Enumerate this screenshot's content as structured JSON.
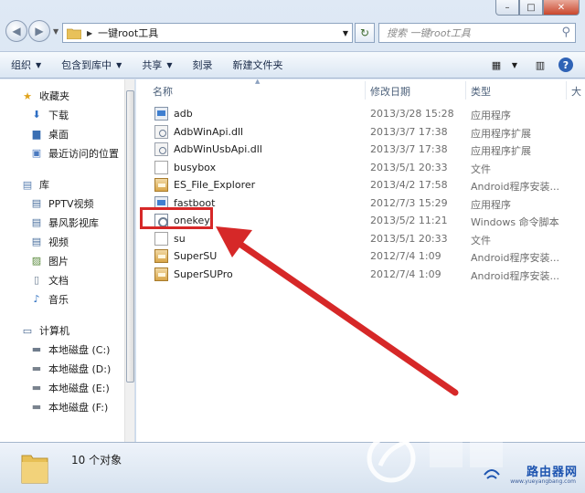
{
  "window": {
    "caption": {
      "min": "–",
      "max": "□",
      "close": "✕"
    }
  },
  "address": {
    "path": "一键root工具",
    "search_placeholder": "搜索 一键root工具"
  },
  "toolbar": {
    "organize": "组织",
    "include_library": "包含到库中",
    "share": "共享",
    "burn": "刻录",
    "new_folder": "新建文件夹"
  },
  "navpane": {
    "favorites": {
      "label": "收藏夹",
      "items": [
        "下载",
        "桌面",
        "最近访问的位置"
      ]
    },
    "libraries": {
      "label": "库",
      "items": [
        "PPTV视频",
        "暴风影视库",
        "视频",
        "图片",
        "文档",
        "音乐"
      ]
    },
    "computer": {
      "label": "计算机",
      "items": [
        "本地磁盘 (C:)",
        "本地磁盘 (D:)",
        "本地磁盘 (E:)",
        "本地磁盘 (F:)"
      ]
    }
  },
  "columns": {
    "name": "名称",
    "date": "修改日期",
    "type": "类型",
    "size": "大"
  },
  "files": [
    {
      "name": "adb",
      "date": "2013/3/28 15:28",
      "type": "应用程序",
      "icon": "exe-icon"
    },
    {
      "name": "AdbWinApi.dll",
      "date": "2013/3/7 17:38",
      "type": "应用程序扩展",
      "icon": "dll-icon"
    },
    {
      "name": "AdbWinUsbApi.dll",
      "date": "2013/3/7 17:38",
      "type": "应用程序扩展",
      "icon": "dll-icon"
    },
    {
      "name": "busybox",
      "date": "2013/5/1 20:33",
      "type": "文件",
      "icon": "file-icon"
    },
    {
      "name": "ES_File_Explorer",
      "date": "2013/4/2 17:58",
      "type": "Android程序安装...",
      "icon": "apk-icon"
    },
    {
      "name": "fastboot",
      "date": "2012/7/3 15:29",
      "type": "应用程序",
      "icon": "exe-icon"
    },
    {
      "name": "onekey",
      "date": "2013/5/2 11:21",
      "type": "Windows 命令脚本",
      "icon": "cmd-icon"
    },
    {
      "name": "su",
      "date": "2013/5/1 20:33",
      "type": "文件",
      "icon": "file-icon"
    },
    {
      "name": "SuperSU",
      "date": "2012/7/4 1:09",
      "type": "Android程序安装...",
      "icon": "apk-icon"
    },
    {
      "name": "SuperSUPro",
      "date": "2012/7/4 1:09",
      "type": "Android程序安装...",
      "icon": "apk-icon"
    }
  ],
  "status": {
    "count": "10 个对象"
  },
  "watermark": {
    "logo": "路由器网",
    "url": "www.yueyangbang.com"
  },
  "colors": {
    "highlight": "#d62828",
    "accent": "#2f63b6"
  }
}
